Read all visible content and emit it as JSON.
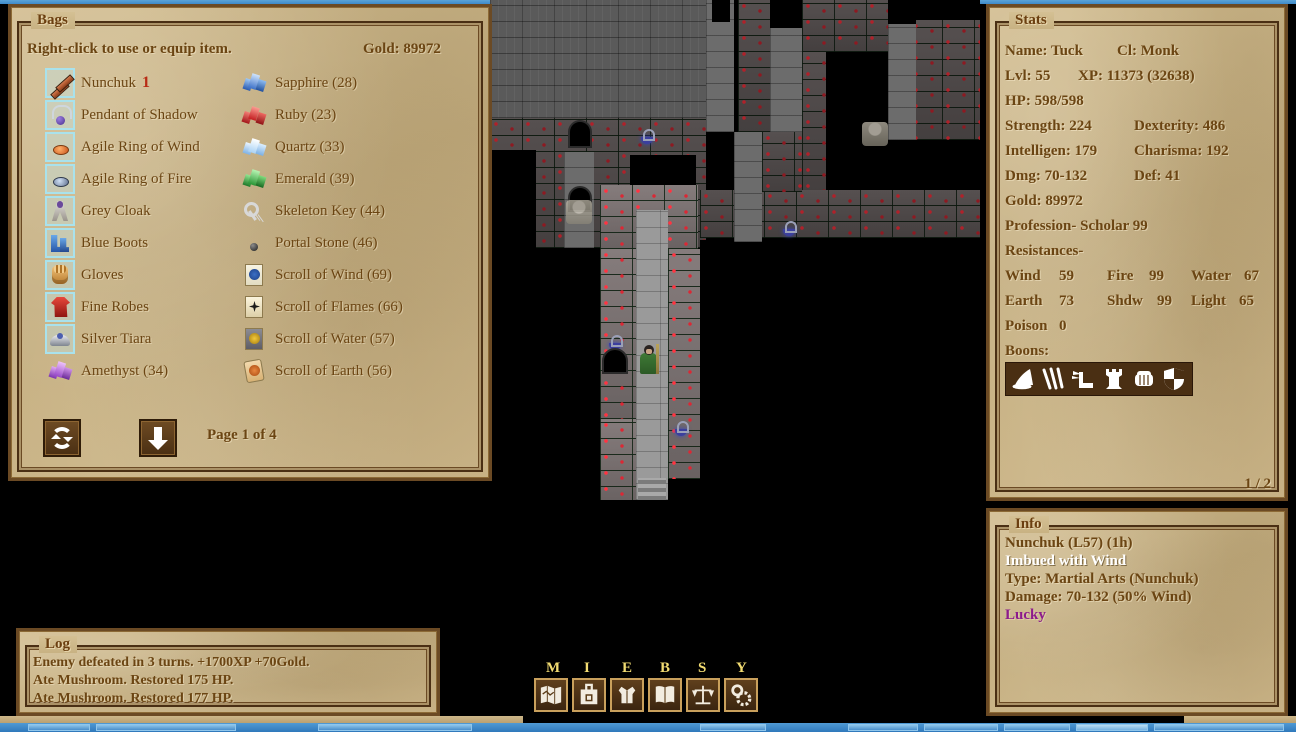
{
  "bags": {
    "title": "Bags",
    "hint": "Right-click to use or equip item.",
    "gold": "Gold: 89972",
    "page": "Page 1 of 4",
    "refresh_label": "refresh",
    "down_label": "next page",
    "left_column": [
      {
        "name": "Nunchuk",
        "qty": "1",
        "qty_red": true,
        "icon": "nunchuk-icon",
        "equipped": true
      },
      {
        "name": "Pendant of Shadow",
        "qty": "",
        "icon": "pendant-icon",
        "equipped": true
      },
      {
        "name": "Agile Ring of Wind",
        "qty": "",
        "icon": "ring-fire-icon",
        "equipped": true
      },
      {
        "name": "Agile Ring of Fire",
        "qty": "",
        "icon": "ring-wind-icon",
        "equipped": true
      },
      {
        "name": "Grey Cloak",
        "qty": "",
        "icon": "cloak-icon",
        "equipped": true
      },
      {
        "name": "Blue Boots",
        "qty": "",
        "icon": "boots-icon",
        "equipped": true
      },
      {
        "name": "Gloves",
        "qty": "",
        "icon": "gloves-icon",
        "equipped": true
      },
      {
        "name": "Fine Robes",
        "qty": "",
        "icon": "robes-icon",
        "equipped": true
      },
      {
        "name": "Silver Tiara",
        "qty": "",
        "icon": "tiara-icon",
        "equipped": true
      },
      {
        "name": "Amethyst (34)",
        "qty": "",
        "icon": "amethyst-icon",
        "equipped": false
      }
    ],
    "right_column": [
      {
        "name": "Sapphire (28)",
        "icon": "sapphire-icon"
      },
      {
        "name": "Ruby (23)",
        "icon": "ruby-icon"
      },
      {
        "name": "Quartz (33)",
        "icon": "quartz-icon"
      },
      {
        "name": "Emerald (39)",
        "icon": "emerald-icon"
      },
      {
        "name": "Skeleton Key (44)",
        "icon": "skeleton-key-icon"
      },
      {
        "name": "Portal Stone (46)",
        "icon": "portal-stone-icon"
      },
      {
        "name": "Scroll of Wind (69)",
        "icon": "scroll-wind-icon"
      },
      {
        "name": "Scroll of Flames (66)",
        "icon": "scroll-flames-icon"
      },
      {
        "name": "Scroll of Water (57)",
        "icon": "scroll-water-icon"
      },
      {
        "name": "Scroll of Earth (56)",
        "icon": "scroll-earth-icon"
      }
    ]
  },
  "stats": {
    "title": "Stats",
    "name_label": "Name: Tuck",
    "class_label": "Cl: Monk",
    "lvl": "Lvl: 55",
    "xp": "XP: 11373 (32638)",
    "hp": "HP: 598/598",
    "strength": "Strength: 224",
    "dexterity": "Dexterity: 486",
    "intelligence": "Intelligen: 179",
    "charisma": "Charisma: 192",
    "dmg": "Dmg: 70-132",
    "def": "Def: 41",
    "gold": "Gold: 89972",
    "profession": "Profession- Scholar 99",
    "resistances_label": "Resistances-",
    "res": {
      "wind_n": "Wind",
      "wind_v": "59",
      "fire_n": "Fire",
      "fire_v": "99",
      "water_n": "Water",
      "water_v": "67",
      "earth_n": "Earth",
      "earth_v": "73",
      "shdw_n": "Shdw",
      "shdw_v": "99",
      "light_n": "Light",
      "light_v": "65",
      "poison_n": "Poison",
      "poison_v": "0"
    },
    "boons_label": "Boons:",
    "boons": [
      "wizard-hat-icon",
      "claw-slash-icon",
      "winged-boot-icon",
      "tower-icon",
      "fist-icon",
      "shield-icon"
    ],
    "pager": "1 / 2"
  },
  "info": {
    "title": "Info",
    "item_name": "Nunchuk (L57) (1h)",
    "imbue": "Imbued with Wind",
    "type": "Type: Martial Arts (Nunchuk)",
    "damage": "Damage: 70-132 (50% Wind)",
    "trait": "Lucky"
  },
  "log": {
    "title": "Log",
    "lines": [
      "Enemy defeated in 3 turns. +1700XP +70Gold.",
      "Ate Mushroom. Restored 175 HP.",
      "Ate Mushroom. Restored 177 HP."
    ]
  },
  "toolbar": {
    "buttons": [
      {
        "key": "M",
        "icon": "map-icon",
        "name": "map"
      },
      {
        "key": "I",
        "icon": "backpack-icon",
        "name": "inventory"
      },
      {
        "key": "E",
        "icon": "armor-icon",
        "name": "equipment"
      },
      {
        "key": "B",
        "icon": "book-icon",
        "name": "book"
      },
      {
        "key": "S",
        "icon": "scales-icon",
        "name": "skills"
      },
      {
        "key": "Y",
        "icon": "gears-icon",
        "name": "settings"
      }
    ]
  },
  "colors": {
    "parchment": "#c9b488",
    "ink": "#6b4513",
    "title_ink": "#6b3f10",
    "accent_red": "#b82b15",
    "purple": "#8c1a8c",
    "panel_border": "#4a2f14",
    "button_brown": "#4a2f13",
    "key_yellow": "#f2dc72",
    "equip_highlight": "#a9e2ec"
  }
}
